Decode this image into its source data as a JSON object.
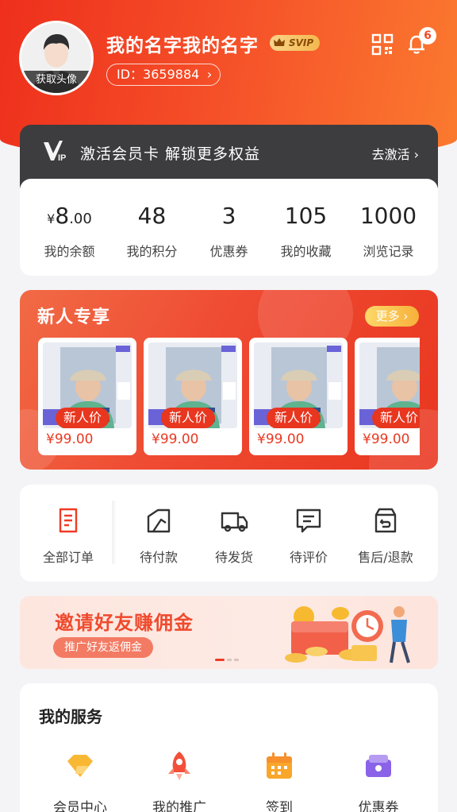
{
  "profile": {
    "avatar_label": "获取头像",
    "username": "我的名字我的名字",
    "vip_badge": "SVIP",
    "id_text": "ID：3659884",
    "notification_count": "6"
  },
  "vip_banner": {
    "logo_text": "VIP",
    "text": "激活会员卡 解锁更多权益",
    "action": "去激活"
  },
  "stats": [
    {
      "currency": "¥",
      "integer": "8",
      "decimal": ".00",
      "label": "我的余额"
    },
    {
      "value": "48",
      "label": "我的积分"
    },
    {
      "value": "3",
      "label": "优惠券"
    },
    {
      "value": "105",
      "label": "我的收藏"
    },
    {
      "value": "1000",
      "label": "浏览记录"
    }
  ],
  "newbie": {
    "title": "新人专享",
    "more": "更多",
    "products": [
      {
        "tag": "新人价",
        "price": "¥99.00"
      },
      {
        "tag": "新人价",
        "price": "¥99.00"
      },
      {
        "tag": "新人价",
        "price": "¥99.00"
      },
      {
        "tag": "新人价",
        "price": "¥99.00"
      }
    ]
  },
  "orders": [
    {
      "label": "全部订单",
      "icon": "receipt-icon"
    },
    {
      "label": "待付款",
      "icon": "wallet-icon"
    },
    {
      "label": "待发货",
      "icon": "truck-icon"
    },
    {
      "label": "待评价",
      "icon": "comment-icon"
    },
    {
      "label": "售后/退款",
      "icon": "refund-icon"
    }
  ],
  "invite": {
    "title": "邀请好友赚佣金",
    "subtitle": "推广好友返佣金"
  },
  "services": {
    "title": "我的服务",
    "items": [
      {
        "label": "会员中心",
        "icon": "diamond-icon"
      },
      {
        "label": "我的推广",
        "icon": "rocket-icon"
      },
      {
        "label": "签到",
        "icon": "calendar-icon"
      },
      {
        "label": "优惠券",
        "icon": "coupon-icon"
      }
    ]
  },
  "colors": {
    "accent": "#ef3b24",
    "header_gradient_end": "#fb7a2f",
    "vip_card": "#3d3d3f",
    "price": "#e83a22"
  }
}
